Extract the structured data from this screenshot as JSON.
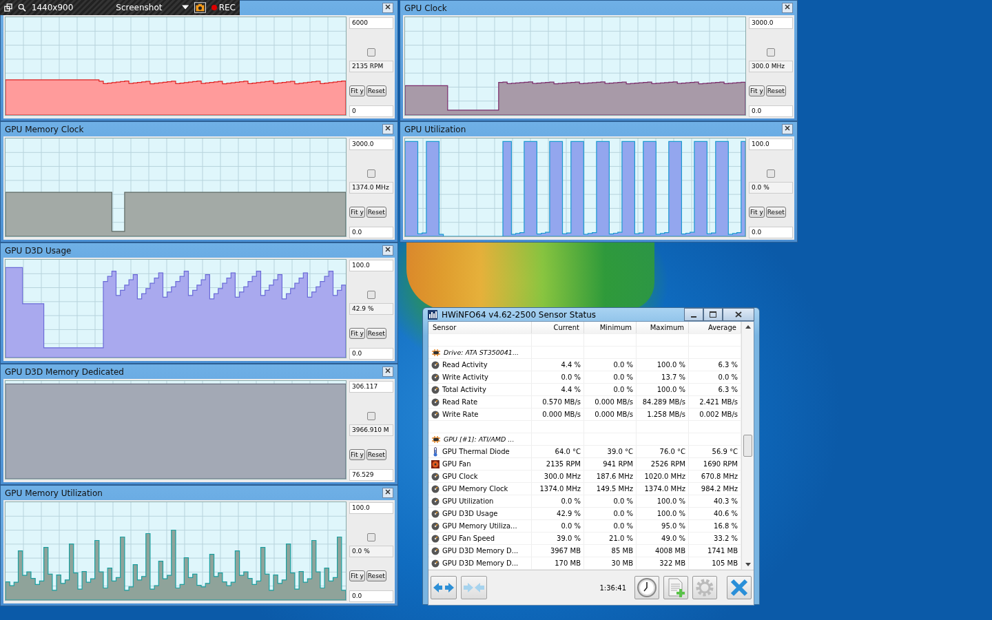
{
  "recorder": {
    "resolution": "1440x900",
    "mode": "Screenshot",
    "rec": "REC"
  },
  "graphs": [
    {
      "color": "#ff9b9b",
      "max": "6000",
      "reading": "2135 RPM",
      "buttons": [
        "Fit y",
        "Reset"
      ],
      "min": "0",
      "checked": false
    },
    {
      "title": "GPU Memory Clock",
      "color": "#a3aaa6",
      "max": "3000.0",
      "reading": "1374.0 MHz",
      "buttons": [
        "Fit y",
        "Reset"
      ],
      "min": "0.0",
      "checked": false
    },
    {
      "title": "GPU D3D Usage",
      "color": "#a9a9ee",
      "max": "100.0",
      "reading": "42.9 %",
      "buttons": [
        "Fit y",
        "Reset"
      ],
      "min": "0.0",
      "checked": false
    },
    {
      "title": "GPU D3D Memory Dedicated",
      "color": "#a3a9b5",
      "max": "306.117",
      "reading": "3966.910 M",
      "buttons": [
        "Fit y",
        "Reset"
      ],
      "min": "76.529",
      "checked": false
    },
    {
      "title": "GPU Memory Utilization",
      "color": "#8fa39a",
      "max": "100.0",
      "reading": "0.0 %",
      "buttons": [
        "Fit y",
        "Reset"
      ],
      "min": "0.0",
      "checked": false
    },
    {
      "title": "GPU Clock",
      "color": "#a89aa8",
      "max": "3000.0",
      "reading": "300.0 MHz",
      "buttons": [
        "Fit y",
        "Reset"
      ],
      "min": "0.0",
      "checked": false
    },
    {
      "title": "GPU Utilization",
      "color": "#93a6ee",
      "max": "100.0",
      "reading": "0.0 %",
      "buttons": [
        "Fit y",
        "Reset"
      ],
      "min": "0.0",
      "checked": false
    }
  ],
  "sensor_window": {
    "title": "HWiNFO64 v4.62-2500 Sensor Status",
    "columns": [
      "Sensor",
      "Current",
      "Minimum",
      "Maximum",
      "Average"
    ],
    "rows": [
      {
        "kind": "group",
        "name": "Drive: ATA ST350041..."
      },
      {
        "kind": "sensor",
        "name": "Read Activity",
        "values": [
          "4.4 %",
          "0.0 %",
          "100.0 %",
          "6.3 %"
        ]
      },
      {
        "kind": "sensor",
        "name": "Write Activity",
        "values": [
          "0.0 %",
          "0.0 %",
          "13.7 %",
          "0.0 %"
        ]
      },
      {
        "kind": "sensor",
        "name": "Total Activity",
        "values": [
          "4.4 %",
          "0.0 %",
          "100.0 %",
          "6.3 %"
        ]
      },
      {
        "kind": "sensor",
        "name": "Read Rate",
        "values": [
          "0.570 MB/s",
          "0.000 MB/s",
          "84.289 MB/s",
          "2.421 MB/s"
        ]
      },
      {
        "kind": "sensor",
        "name": "Write Rate",
        "values": [
          "0.000 MB/s",
          "0.000 MB/s",
          "1.258 MB/s",
          "0.002 MB/s"
        ]
      },
      {
        "kind": "group",
        "name": "GPU [#1]: ATI/AMD ..."
      },
      {
        "kind": "temperature",
        "name": "GPU Thermal Diode",
        "values": [
          "64.0 °C",
          "39.0 °C",
          "76.0 °C",
          "56.9 °C"
        ]
      },
      {
        "kind": "fan",
        "name": "GPU Fan",
        "values": [
          "2135 RPM",
          "941 RPM",
          "2526 RPM",
          "1690 RPM"
        ]
      },
      {
        "kind": "sensor",
        "name": "GPU Clock",
        "values": [
          "300.0 MHz",
          "187.6 MHz",
          "1020.0 MHz",
          "670.8 MHz"
        ]
      },
      {
        "kind": "sensor",
        "name": "GPU Memory Clock",
        "values": [
          "1374.0 MHz",
          "149.5 MHz",
          "1374.0 MHz",
          "984.2 MHz"
        ]
      },
      {
        "kind": "sensor",
        "name": "GPU Utilization",
        "values": [
          "0.0 %",
          "0.0 %",
          "100.0 %",
          "40.3 %"
        ]
      },
      {
        "kind": "sensor",
        "name": "GPU D3D Usage",
        "values": [
          "42.9 %",
          "0.0 %",
          "100.0 %",
          "40.6 %"
        ]
      },
      {
        "kind": "sensor",
        "name": "GPU Memory Utiliza...",
        "values": [
          "0.0 %",
          "0.0 %",
          "95.0 %",
          "16.8 %"
        ]
      },
      {
        "kind": "sensor",
        "name": "GPU Fan Speed",
        "values": [
          "39.0 %",
          "21.0 %",
          "49.0 %",
          "33.2 %"
        ]
      },
      {
        "kind": "sensor",
        "name": "GPU D3D Memory D...",
        "values": [
          "3967 MB",
          "85 MB",
          "4008 MB",
          "1741 MB"
        ]
      },
      {
        "kind": "sensor",
        "name": "GPU D3D Memory D...",
        "values": [
          "170 MB",
          "30 MB",
          "322 MB",
          "105 MB"
        ]
      }
    ],
    "time": "1:36:41"
  }
}
